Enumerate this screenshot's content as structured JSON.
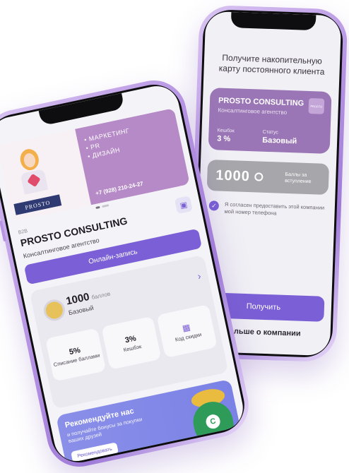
{
  "back_phone": {
    "title": "Получите накопительную карту постоянного клиента",
    "card": {
      "company": "PROSTO CONSULTING",
      "subtitle": "Консалтинговое агентство",
      "logo_text": "PROSTO",
      "cashback_label": "Кешбэк",
      "cashback_value": "3 %",
      "status_label": "Статус",
      "status_value": "Базовый"
    },
    "points": {
      "value": "1000",
      "caption": "Баллы за вступление"
    },
    "consent": "Я согласен предоставить этой компании мой номер телефона",
    "get_button": "Получить",
    "more_link": "больше о компании"
  },
  "front_phone": {
    "banner": {
      "services": [
        "МАРКЕТИНГ",
        "PR",
        "ДИЗАЙН"
      ],
      "phone": "+7 (928) 210-24-27",
      "sign": "PROSTO"
    },
    "tag": "B2B",
    "company": "PROSTO CONSULTING",
    "description": "Консалтинговое агентство",
    "book_button": "Онлайн-запись",
    "loyalty": {
      "points": "1000",
      "points_unit": "баллов",
      "status": "Базовый",
      "tiles": [
        {
          "value": "5%",
          "label": "Списание баллами"
        },
        {
          "value": "3%",
          "label": "Кешбэк"
        },
        {
          "value": "",
          "label": "Код скидки"
        }
      ]
    },
    "refer": {
      "title": "Рекомендуйте нас",
      "text": "и получайте бонусы за покупки ваших друзей",
      "button": "Рекомендовать"
    }
  },
  "colors": {
    "accent": "#7a5fd6",
    "card": "#9b76b7",
    "banner": "#b58ac7",
    "frame": "#b795e3"
  }
}
